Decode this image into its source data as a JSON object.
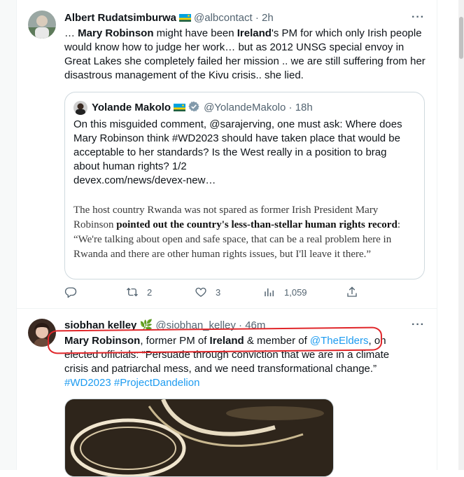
{
  "tweet1": {
    "author_name": "Albert Rudatsimburwa",
    "author_handle": "@albcontact",
    "sep": "·",
    "time": "2h",
    "more": "···",
    "text": {
      "p1": "… ",
      "b1": "Mary Robinson",
      "p2": " might have been ",
      "b2": "Ireland",
      "p3": "'s PM for which only Irish people would know how to judge her work… but as 2012 UNSG special envoy in Great Lakes she completely failed her mission .. we are still suffering from her disastrous management of the Kivu crisis.. she lied."
    },
    "quote": {
      "author_name": "Yolande Makolo",
      "author_handle": "@YolandeMakolo",
      "sep": "·",
      "time": "18h",
      "text_a": "On this misguided comment, ",
      "text_mention": "@sarajerving",
      "text_b": ", one must ask: Where does Mary Robinson think #WD2023 should have taken place that would be acceptable to her standards? Is the West really in a position to brag about human rights? 1/2",
      "url": "devex.com/news/devex-new…",
      "article": {
        "a1": "The host country Rwanda was not spared as former Irish President Mary Robinson ",
        "b1": "pointed out the country's less-than-stellar human rights record",
        "a2": ": “We're talking about open and safe space, that can be a real problem here in Rwanda and there are other human rights issues, but I'll leave it there.”"
      }
    },
    "actions": {
      "replies": "",
      "retweets": "2",
      "likes": "3",
      "views": "1,059"
    }
  },
  "tweet2": {
    "author_name": "siobhan kelley",
    "author_emoji": "🌿",
    "author_handle": "@siobhan_kelley",
    "sep": "·",
    "time": "46m",
    "more": "···",
    "text": {
      "b1": "Mary Robinson",
      "p1": ", former PM of ",
      "b2": "Ireland",
      "p2": " & member of ",
      "mention": "@TheElders",
      "p3": ", on elected officials: “Persuade through conviction that we are in a climate crisis and patriarchal mess, and we need transformational change.”",
      "hashtags": "#WD2023 #ProjectDandelion"
    }
  },
  "colors": {
    "accent": "#1d9bf0",
    "annotation": "#e0262a",
    "rwanda_blue": "#20603d"
  }
}
